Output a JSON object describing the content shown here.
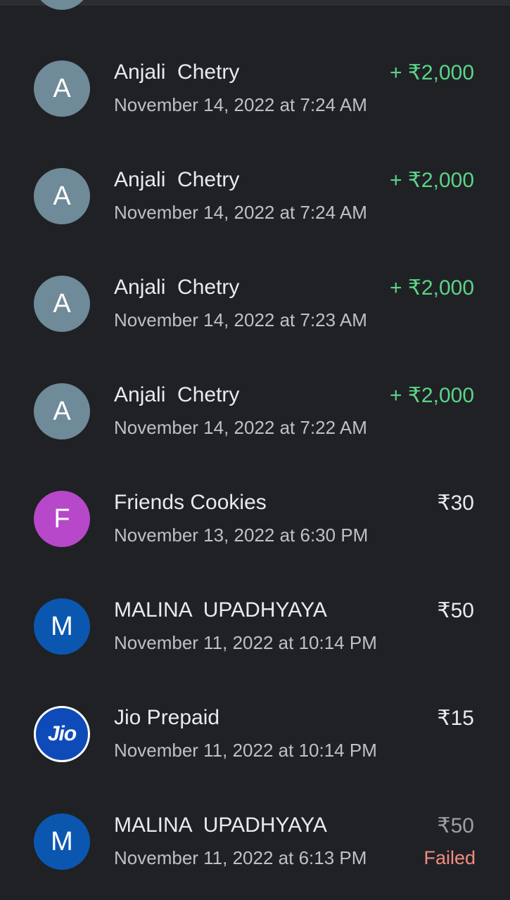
{
  "colors": {
    "background": "#202124",
    "credit": "#5bd48a",
    "failed": "#f28b82"
  },
  "transactions": [
    {
      "initial": "A",
      "avatar_color": "#6f8a98",
      "name": "Anjali  Chetry",
      "date": "November 14, 2022 at 7:24 AM",
      "amount": "+ ₹2,000",
      "type": "credit",
      "status": ""
    },
    {
      "initial": "A",
      "avatar_color": "#6f8a98",
      "name": "Anjali  Chetry",
      "date": "November 14, 2022 at 7:24 AM",
      "amount": "+ ₹2,000",
      "type": "credit",
      "status": ""
    },
    {
      "initial": "A",
      "avatar_color": "#6f8a98",
      "name": "Anjali  Chetry",
      "date": "November 14, 2022 at 7:23 AM",
      "amount": "+ ₹2,000",
      "type": "credit",
      "status": ""
    },
    {
      "initial": "A",
      "avatar_color": "#6f8a98",
      "name": "Anjali  Chetry",
      "date": "November 14, 2022 at 7:22 AM",
      "amount": "+ ₹2,000",
      "type": "credit",
      "status": ""
    },
    {
      "initial": "F",
      "avatar_color": "#b648c9",
      "name": "Friends Cookies",
      "date": "November 13, 2022 at 6:30 PM",
      "amount": "₹30",
      "type": "debit",
      "status": ""
    },
    {
      "initial": "M",
      "avatar_color": "#0b57b0",
      "name": "MALINA  UPADHYAYA",
      "date": "November 11, 2022 at 10:14 PM",
      "amount": "₹50",
      "type": "debit",
      "status": ""
    },
    {
      "initial": "Jio",
      "avatar_color": "#0f4bb8",
      "name": "Jio Prepaid",
      "date": "November 11, 2022 at 10:14 PM",
      "amount": "₹15",
      "type": "debit",
      "status": ""
    },
    {
      "initial": "M",
      "avatar_color": "#0b57b0",
      "name": "MALINA  UPADHYAYA",
      "date": "November 11, 2022 at 6:13 PM",
      "amount": "₹50",
      "type": "failed",
      "status": "Failed"
    }
  ]
}
